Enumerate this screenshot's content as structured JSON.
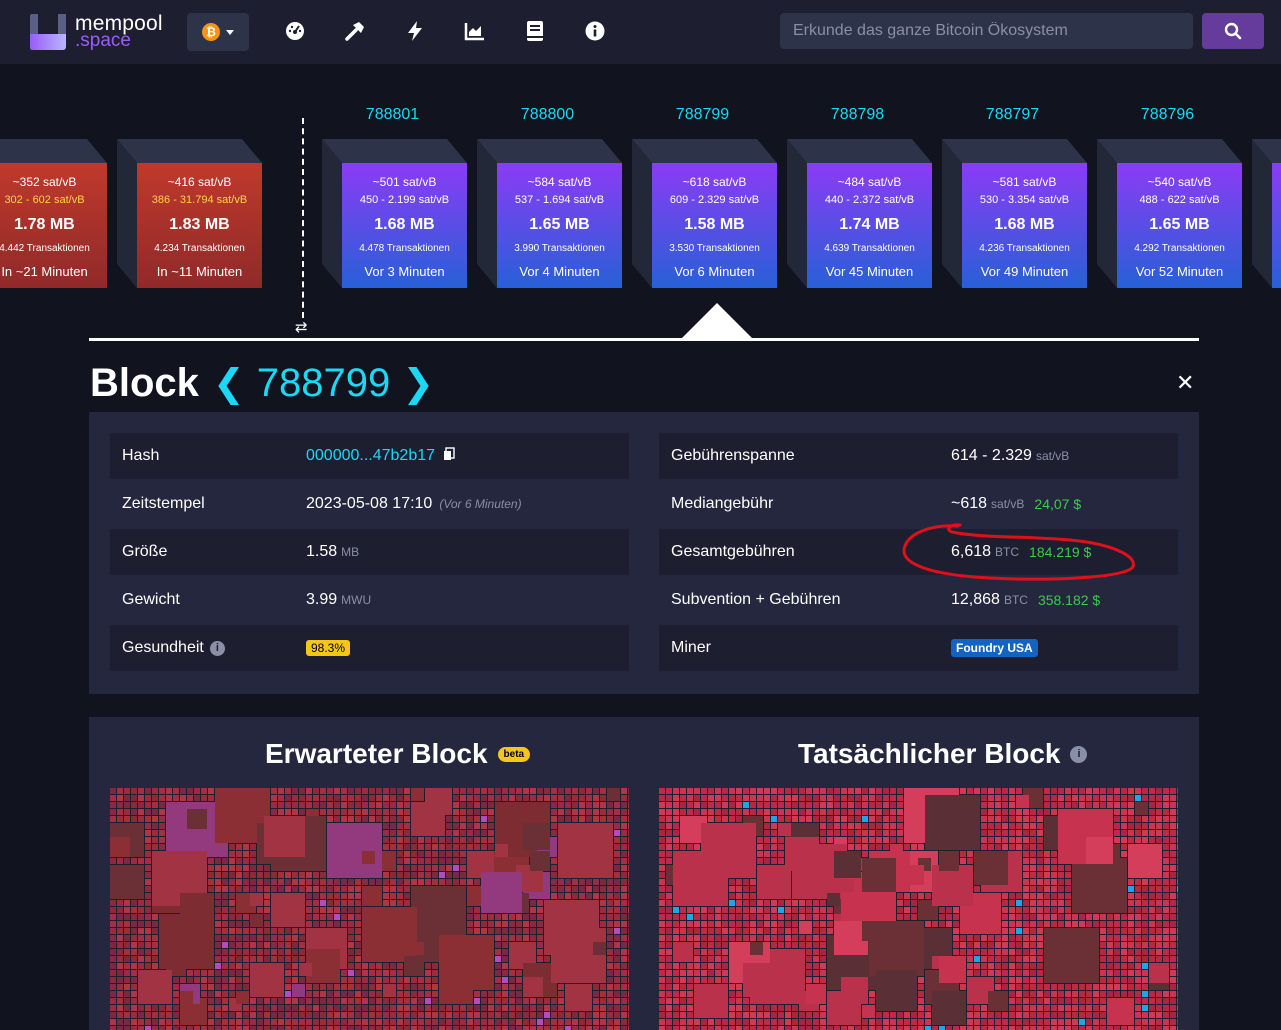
{
  "header": {
    "logo_top": "mempool",
    "logo_bottom": ".space",
    "network_symbol": "₿",
    "nav_icons": [
      "dashboard-icon",
      "mining-icon",
      "lightning-icon",
      "graphs-icon",
      "docs-icon",
      "about-icon"
    ],
    "search_placeholder": "Erkunde das ganze Bitcoin Ökosystem"
  },
  "blocks": {
    "mempool": [
      {
        "fee": "~352 sat/vB",
        "range": "302 - 602 sat/vB",
        "size": "1.78 MB",
        "tx": "4.442 Transaktionen",
        "time": "In ~21 Minuten"
      },
      {
        "fee": "~416 sat/vB",
        "range": "386 - 31.794 sat/vB",
        "size": "1.83 MB",
        "tx": "4.234 Transaktionen",
        "time": "In ~11 Minuten"
      }
    ],
    "mined": [
      {
        "height": "788801",
        "fee": "~501 sat/vB",
        "range": "450 - 2.199 sat/vB",
        "size": "1.68 MB",
        "tx": "4.478 Transaktionen",
        "time": "Vor 3 Minuten"
      },
      {
        "height": "788800",
        "fee": "~584 sat/vB",
        "range": "537 - 1.694 sat/vB",
        "size": "1.65 MB",
        "tx": "3.990 Transaktionen",
        "time": "Vor 4 Minuten"
      },
      {
        "height": "788799",
        "fee": "~618 sat/vB",
        "range": "609 - 2.329 sat/vB",
        "size": "1.58 MB",
        "tx": "3.530 Transaktionen",
        "time": "Vor 6 Minuten"
      },
      {
        "height": "788798",
        "fee": "~484 sat/vB",
        "range": "440 - 2.372 sat/vB",
        "size": "1.74 MB",
        "tx": "4.639 Transaktionen",
        "time": "Vor 45 Minuten"
      },
      {
        "height": "788797",
        "fee": "~581 sat/vB",
        "range": "530 - 3.354 sat/vB",
        "size": "1.68 MB",
        "tx": "4.236 Transaktionen",
        "time": "Vor 49 Minuten"
      },
      {
        "height": "788796",
        "fee": "~540 sat/vB",
        "range": "488 - 622 sat/vB",
        "size": "1.65 MB",
        "tx": "4.292 Transaktionen",
        "time": "Vor 52 Minuten"
      }
    ]
  },
  "block": {
    "title": "Block",
    "height": "788799",
    "left": {
      "hash_label": "Hash",
      "hash_value": "000000...47b2b17",
      "timestamp_label": "Zeitstempel",
      "timestamp_value": "2023-05-08 17:10",
      "timestamp_relative": "(Vor 6 Minuten)",
      "size_label": "Größe",
      "size_value": "1.58",
      "size_unit": "MB",
      "weight_label": "Gewicht",
      "weight_value": "3.99",
      "weight_unit": "MWU",
      "health_label": "Gesundheit",
      "health_value": "98.3%"
    },
    "right": {
      "feespan_label": "Gebührenspanne",
      "feespan_value": "614 - 2.329",
      "feespan_unit": "sat/vB",
      "median_label": "Mediangebühr",
      "median_value": "~618",
      "median_unit": "sat/vB",
      "median_usd": "24,07 $",
      "total_label": "Gesamtgebühren",
      "total_value": "6,618",
      "total_unit": "BTC",
      "total_usd": "184.219 $",
      "subsidy_label": "Subvention + Gebühren",
      "subsidy_value": "12,868",
      "subsidy_unit": "BTC",
      "subsidy_usd": "358.182 $",
      "miner_label": "Miner",
      "miner_value": "Foundry USA"
    }
  },
  "viz": {
    "expected_title": "Erwarteter Block",
    "beta": "beta",
    "actual_title": "Tatsächlicher Block"
  },
  "colors": {
    "accent": "#1bd8f4",
    "green": "#3bcc49",
    "health_badge": "#f5c518",
    "miner_badge": "#1264c2"
  }
}
